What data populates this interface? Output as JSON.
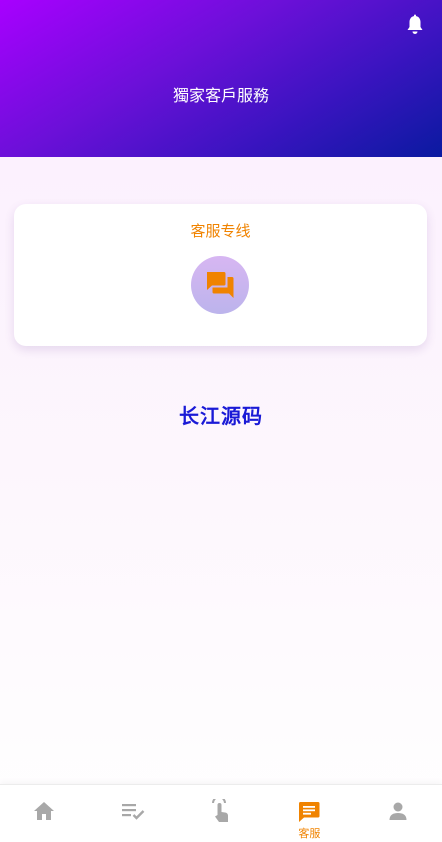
{
  "header": {
    "title": "獨家客戶服務",
    "icon": "bell-icon"
  },
  "service_card": {
    "title": "客服专线",
    "icon": "chat-icon"
  },
  "brand": "长江源码",
  "tabbar": {
    "active_color": "#f08300",
    "inactive_color": "#a8a8a8",
    "items": [
      {
        "icon": "home-icon",
        "label": ""
      },
      {
        "icon": "checklist-icon",
        "label": ""
      },
      {
        "icon": "touch-icon",
        "label": ""
      },
      {
        "icon": "message-icon",
        "label": "客服",
        "active": true
      },
      {
        "icon": "person-icon",
        "label": ""
      }
    ]
  },
  "colors": {
    "header_gradient_start": "#a800ff",
    "header_gradient_end": "#0a1aa0",
    "accent": "#f08300",
    "brand": "#1a1ad6"
  }
}
